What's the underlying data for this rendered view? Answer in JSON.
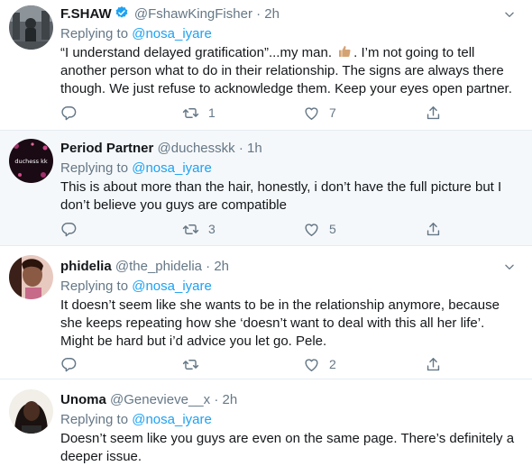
{
  "tweets": [
    {
      "name": "F.SHAW",
      "verified": true,
      "handle": "@FshawKingFisher",
      "dot": "·",
      "time": "2h",
      "replying_prefix": "Replying to ",
      "replying_to": "@nosa_iyare",
      "text_before_emoji": "“I understand delayed gratification”...my man. ",
      "emoji": "thumbs-up",
      "text_after_emoji": ". I’m not going to tell another person what to do in their relationship. The signs are always there though. We just refuse to acknowledge them. Keep your eyes open partner.",
      "reply_count": "",
      "retweet_count": "1",
      "like_count": "7"
    },
    {
      "name": "Period Partner",
      "verified": false,
      "handle": "@duchesskk",
      "dot": "·",
      "time": "1h",
      "avatar_text": "duchess kk",
      "replying_prefix": "Replying to ",
      "replying_to": "@nosa_iyare",
      "text": "This is about more than the hair, honestly, i don’t have the full picture but I don’t believe you guys are compatible",
      "reply_count": "",
      "retweet_count": "3",
      "like_count": "5"
    },
    {
      "name": "phidelia",
      "verified": false,
      "handle": "@the_phidelia",
      "dot": "·",
      "time": "2h",
      "replying_prefix": "Replying to ",
      "replying_to": "@nosa_iyare",
      "text": "It doesn’t seem like she wants to be in the relationship anymore, because she keeps repeating how she ‘doesn’t want to deal with this all her life’. Might be hard but i’d advice you let go. Pele.",
      "reply_count": "",
      "retweet_count": "",
      "like_count": "2"
    },
    {
      "name": "Unoma",
      "verified": false,
      "handle": "@Genevieve__x",
      "dot": "·",
      "time": "2h",
      "replying_prefix": "Replying to ",
      "replying_to": "@nosa_iyare",
      "text": "Doesn’t seem like you guys are even on the same page. There’s definitely a deeper issue."
    }
  ],
  "colors": {
    "accent": "#1da1f2",
    "muted": "#657786",
    "text": "#14171a",
    "divider": "#e6ecf0",
    "hover_bg": "#f5f8fa"
  }
}
